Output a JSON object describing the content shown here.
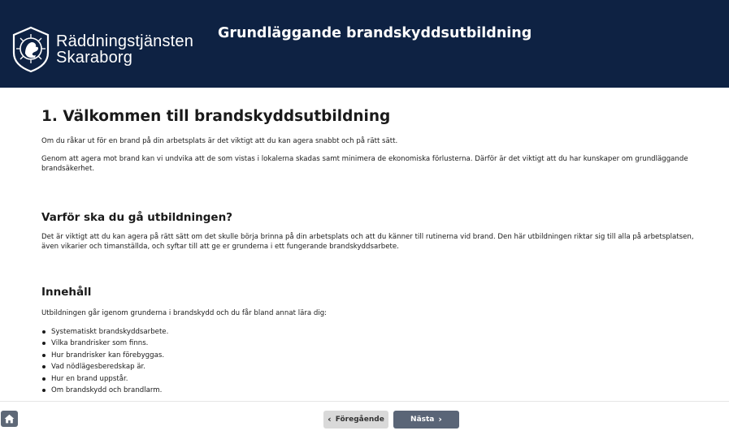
{
  "header": {
    "logo": {
      "line1": "Räddningstjänsten",
      "line2": "Skaraborg"
    },
    "course_title": "Grundläggande brandskyddsutbildning"
  },
  "main": {
    "title": "1. Välkommen till brandskyddsutbildning",
    "intro1": "Om du råkar ut för en brand på din arbetsplats är det viktigt att du kan agera snabbt och på rätt sätt.",
    "intro2": "Genom att agera mot brand kan vi undvika att de som vistas i lokalerna skadas samt minimera de ekonomiska förlusterna. Därför är det viktigt att du har kunskaper om grundläggande brandsäkerhet.",
    "why_heading": "Varför ska du gå utbildningen?",
    "why_text": "Det är viktigt att du kan agera på rätt sätt om det skulle börja brinna på din arbetsplats och att du känner till rutinerna vid brand. Den här utbildningen riktar sig till alla på arbetsplatsen, även vikarier och timanställda, och syftar till att ge er grunderna i ett fungerande brandskyddsarbete.",
    "content_heading": "Innehåll",
    "content_intro": "Utbildningen går igenom grunderna i brandskydd och du får bland annat lära dig:",
    "content_items": [
      "Systematiskt brandskyddsarbete.",
      "Vilka brandrisker som finns.",
      "Hur brandrisker kan förebyggas.",
      "Vad nödlägesberedskap är.",
      "Hur en brand uppstår.",
      "Om brandskydd och brandlarm."
    ]
  },
  "footer": {
    "home_icon": "home-icon",
    "prev_label": "Föregående",
    "next_label": "Nästa"
  },
  "colors": {
    "header_bg": "#0e2243",
    "prev_bg": "#d9d9d9",
    "next_bg": "#5a6577",
    "home_bg": "#5e6877"
  }
}
